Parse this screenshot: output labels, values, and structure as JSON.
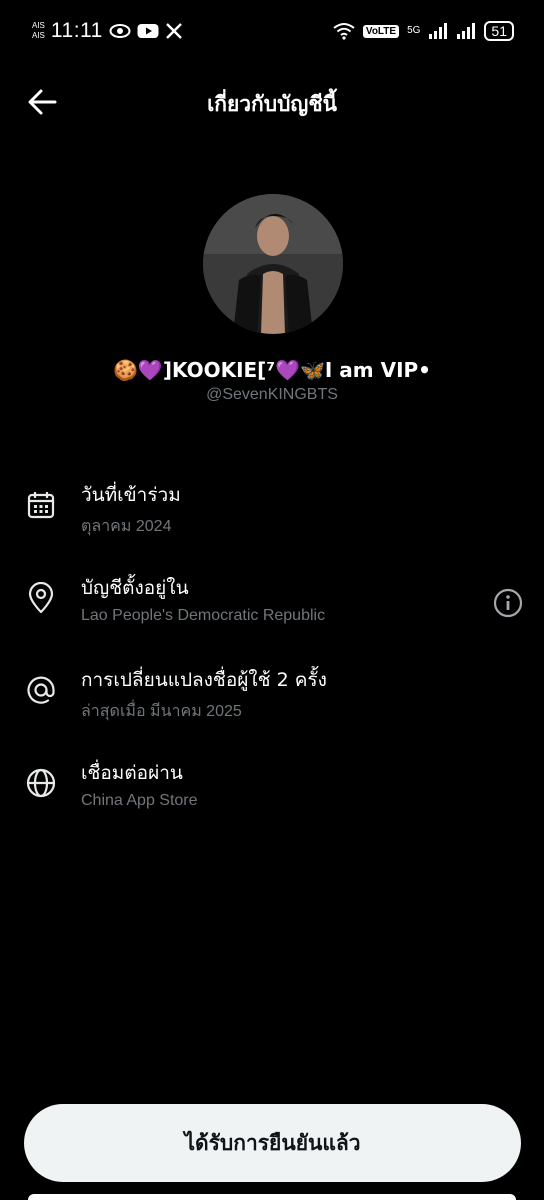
{
  "status_bar": {
    "carrier_1": "AIS",
    "carrier_2": "AIS",
    "time": "11:11",
    "volte": "VoLTE",
    "network": "5G",
    "battery": "51"
  },
  "header": {
    "title": "เกี่ยวกับบัญชีนี้"
  },
  "profile": {
    "display_name": "🍪💜]KOOKIE[⁷💜🦋I am VIP•",
    "handle": "@SevenKINGBTS"
  },
  "info": {
    "joined": {
      "title": "วันที่เข้าร่วม",
      "value": "ตุลาคม 2024"
    },
    "location": {
      "title": "บัญชีตั้งอยู่ใน",
      "value": "Lao People's Democratic Republic"
    },
    "username_changes": {
      "title": "การเปลี่ยนแปลงชื่อผู้ใช้ 2 ครั้ง",
      "value": "ล่าสุดเมื่อ มีนาคม 2025"
    },
    "connected_via": {
      "title": "เชื่อมต่อผ่าน",
      "value": "China App Store"
    }
  },
  "verified_button": {
    "label": "ได้รับการยืนยันแล้ว"
  },
  "colors": {
    "background": "#000000",
    "primary_text": "#e7e9ea",
    "secondary_text": "#71767b",
    "button_bg": "#eff3f4",
    "button_text": "#0f1419"
  }
}
